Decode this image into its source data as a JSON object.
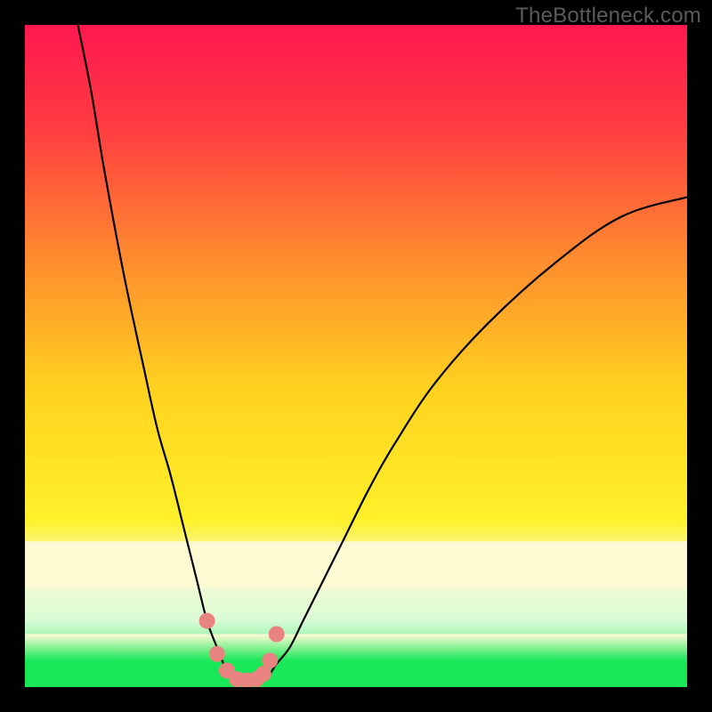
{
  "watermark": "TheBottleneck.com",
  "colors": {
    "frame": "#000000",
    "curve": "#000000",
    "marker": "#e9837f",
    "green": "#18e858"
  },
  "chart_data": {
    "type": "line",
    "title": "",
    "xlabel": "",
    "ylabel": "",
    "xlim": [
      0,
      100
    ],
    "ylim": [
      0,
      100
    ],
    "grid": false,
    "legend": false,
    "series": [
      {
        "name": "left-branch",
        "x": [
          8,
          10,
          12,
          15,
          18,
          20,
          22,
          24,
          26,
          27.5,
          29,
          30,
          31,
          32
        ],
        "values": [
          100,
          90,
          78,
          62,
          48,
          39,
          32,
          24,
          16,
          10,
          6,
          3.5,
          2,
          1
        ]
      },
      {
        "name": "right-branch",
        "x": [
          36,
          37,
          38,
          40,
          42,
          45,
          48,
          52,
          56,
          62,
          70,
          80,
          90,
          100
        ],
        "values": [
          1,
          2,
          3.5,
          6,
          10,
          16,
          22,
          30,
          37,
          46,
          55,
          64,
          71,
          74
        ]
      }
    ],
    "markers": {
      "name": "fit-points",
      "x": [
        27.5,
        29,
        30.5,
        32,
        33.5,
        35,
        36,
        37,
        38
      ],
      "values": [
        10,
        5,
        2.5,
        1.2,
        1,
        1.2,
        2,
        4,
        8
      ],
      "color": "#e9837f",
      "size": 18
    },
    "bands": [
      {
        "name": "pale-yellow",
        "y0": 15,
        "y1": 22,
        "color": "#fdfad4"
      },
      {
        "name": "green",
        "y0": 0,
        "y1": 4,
        "color": "#18e858"
      },
      {
        "name": "green-fade",
        "y0": 4,
        "y1": 8,
        "gradient": [
          "#18e858",
          "#fdfad4"
        ]
      }
    ],
    "background_gradient": {
      "stops": [
        {
          "offset": 0.0,
          "color": "#ff1850"
        },
        {
          "offset": 0.15,
          "color": "#ff3a42"
        },
        {
          "offset": 0.35,
          "color": "#ff8a2f"
        },
        {
          "offset": 0.55,
          "color": "#ffd21f"
        },
        {
          "offset": 0.75,
          "color": "#fff12a"
        },
        {
          "offset": 0.82,
          "color": "#fdfad4"
        },
        {
          "offset": 0.9,
          "color": "#d8fbd4"
        },
        {
          "offset": 0.95,
          "color": "#67f08e"
        },
        {
          "offset": 1.0,
          "color": "#18e858"
        }
      ]
    }
  }
}
